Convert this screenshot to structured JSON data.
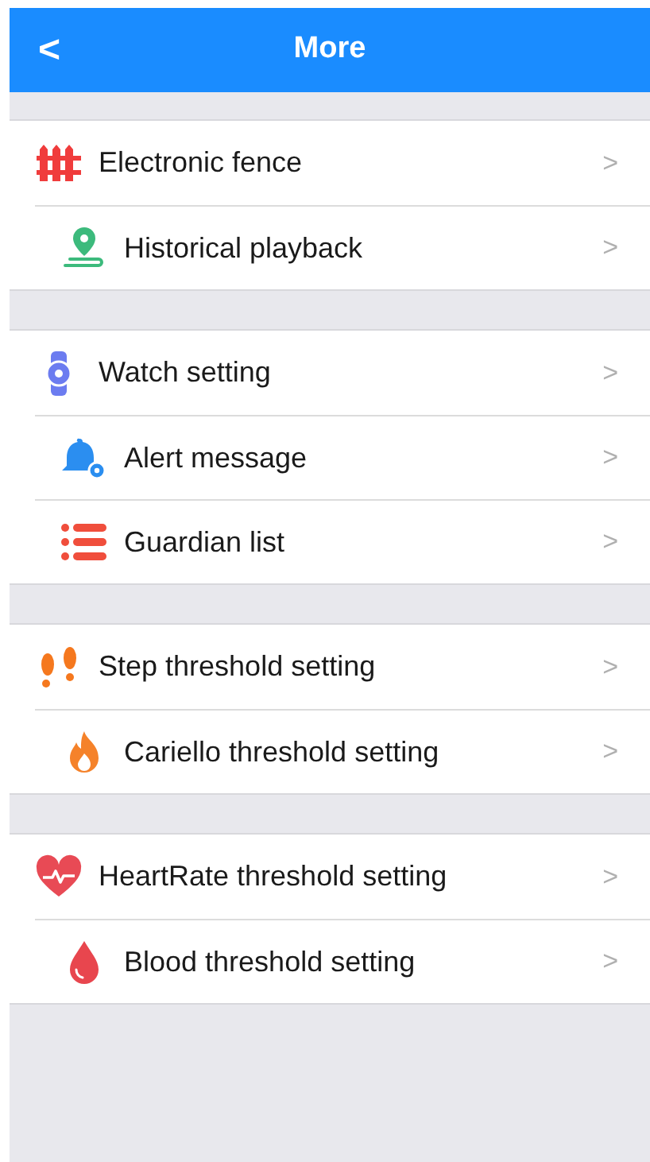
{
  "header": {
    "back": "<",
    "title": "More"
  },
  "groups": [
    {
      "items": [
        {
          "kind": "fence",
          "label": "Electronic fence",
          "chevron": ">"
        },
        {
          "kind": "route",
          "label": "Historical playback",
          "chevron": ">"
        }
      ]
    },
    {
      "items": [
        {
          "kind": "watch",
          "label": "Watch setting",
          "chevron": ">"
        },
        {
          "kind": "alert",
          "label": "Alert message",
          "chevron": ">"
        },
        {
          "kind": "list",
          "label": "Guardian list",
          "chevron": ">"
        }
      ]
    },
    {
      "items": [
        {
          "kind": "steps",
          "label": "Step threshold setting",
          "chevron": ">"
        },
        {
          "kind": "flame",
          "label": "Cariello threshold setting",
          "chevron": ">"
        }
      ]
    },
    {
      "items": [
        {
          "kind": "heart",
          "label": "HeartRate threshold setting",
          "chevron": ">"
        },
        {
          "kind": "drop",
          "label": "Blood threshold setting",
          "chevron": ">"
        }
      ]
    }
  ]
}
